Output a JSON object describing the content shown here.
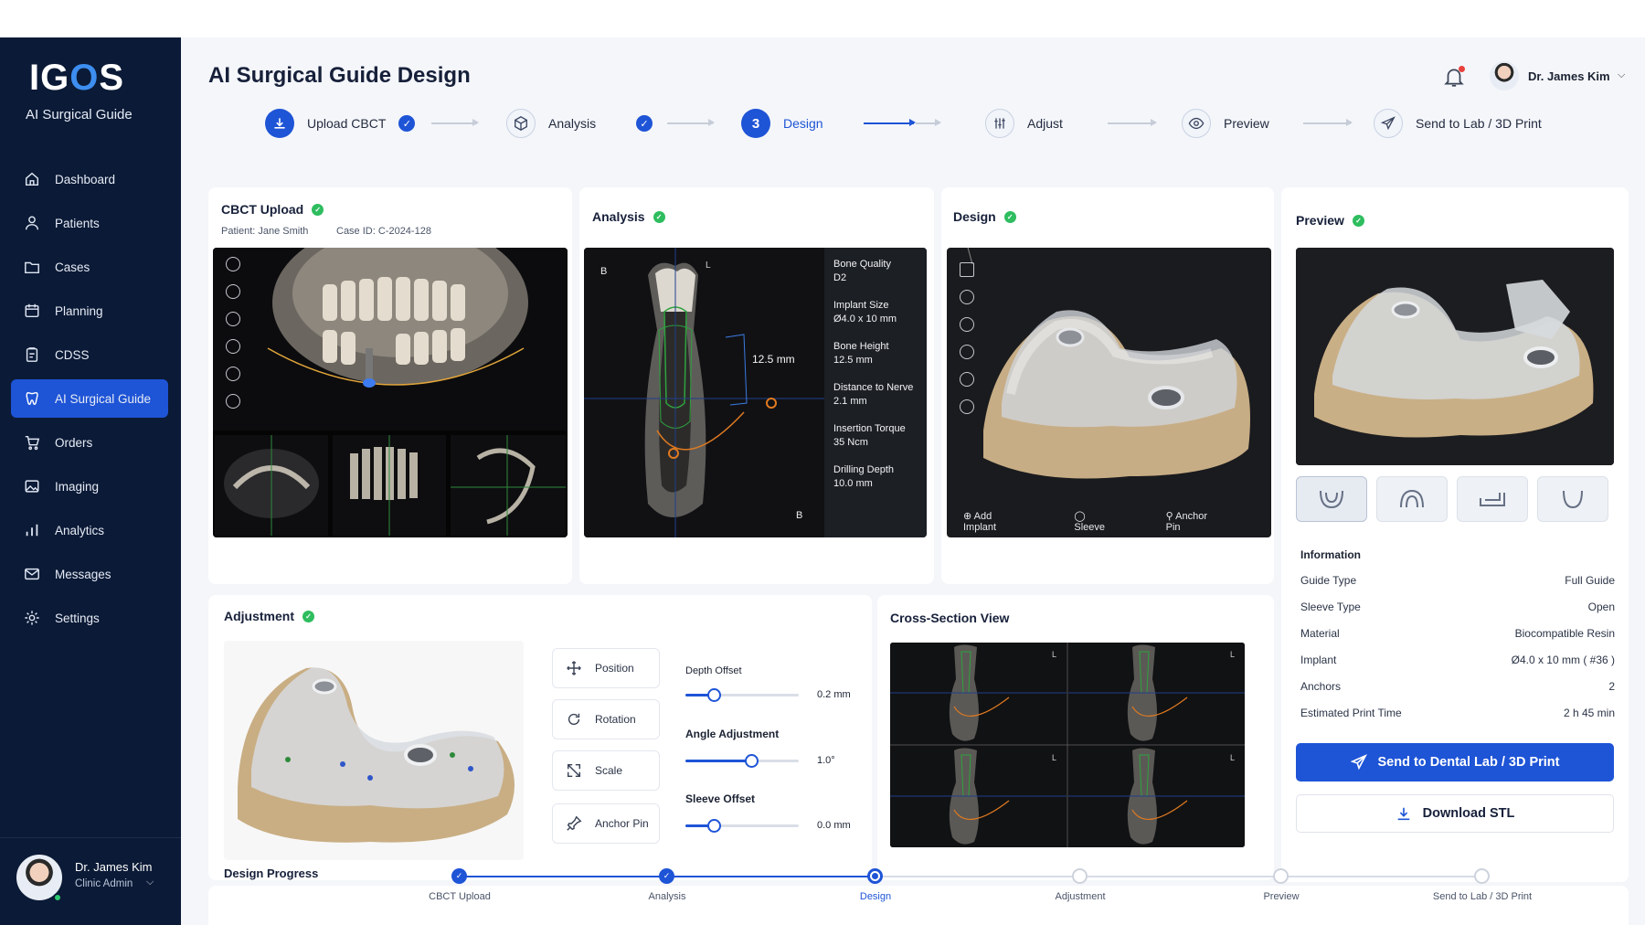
{
  "app": {
    "logo": "IGOS",
    "subtitle": "AI Surgical Guide"
  },
  "sidebar": {
    "items": [
      {
        "label": "Dashboard",
        "icon": "home-icon"
      },
      {
        "label": "Patients",
        "icon": "user-icon"
      },
      {
        "label": "Cases",
        "icon": "folder-icon"
      },
      {
        "label": "Planning",
        "icon": "calendar-icon"
      },
      {
        "label": "CDSS",
        "icon": "clipboard-icon"
      },
      {
        "label": "AI Surgical Guide",
        "icon": "tooth-icon",
        "active": true
      },
      {
        "label": "Orders",
        "icon": "cart-icon"
      },
      {
        "label": "Imaging",
        "icon": "image-icon"
      },
      {
        "label": "Analytics",
        "icon": "bar-chart-icon"
      },
      {
        "label": "Messages",
        "icon": "mail-icon"
      },
      {
        "label": "Settings",
        "icon": "gear-icon"
      }
    ],
    "user": {
      "name": "Dr. James Kim",
      "role": "Clinic Admin"
    }
  },
  "header": {
    "title": "AI Surgical Guide Design",
    "user_name": "Dr. James Kim"
  },
  "stepper": {
    "steps": [
      {
        "label": "Upload CBCT",
        "state": "done"
      },
      {
        "label": "Analysis",
        "state": "done"
      },
      {
        "label": "Design",
        "state": "active",
        "number": "3"
      },
      {
        "label": "Adjust",
        "state": "todo"
      },
      {
        "label": "Preview",
        "state": "todo"
      },
      {
        "label": "Send to Lab / 3D Print",
        "state": "todo"
      }
    ]
  },
  "cbct": {
    "title": "CBCT Upload",
    "patient": "Patient: Jane Smith",
    "case_id": "Case ID: C-2024-128"
  },
  "analysis": {
    "title": "Analysis",
    "labels": {
      "b_top": "B",
      "l_top": "L",
      "b_bottom": "B",
      "measure": "12.5 mm"
    },
    "info": [
      {
        "label": "Bone Quality",
        "value": "D2"
      },
      {
        "label": "Implant Size",
        "value": "Ø4.0 x 10 mm"
      },
      {
        "label": "Bone Height",
        "value": "12.5 mm"
      },
      {
        "label": "Distance to Nerve",
        "value": "2.1 mm"
      },
      {
        "label": "Insertion Torque",
        "value": "35 Ncm"
      },
      {
        "label": "Drilling Depth",
        "value": "10.0 mm"
      }
    ]
  },
  "design": {
    "title": "Design",
    "tools": [
      "Add Implant",
      "Sleeve",
      "Anchor Pin"
    ]
  },
  "preview": {
    "title": "Preview",
    "info_title": "Information",
    "info": [
      {
        "label": "Guide Type",
        "value": "Full Guide"
      },
      {
        "label": "Sleeve Type",
        "value": "Open"
      },
      {
        "label": "Material",
        "value": "Biocompatible Resin"
      },
      {
        "label": "Implant",
        "value": "Ø4.0 x 10 mm ( #36 )"
      },
      {
        "label": "Anchors",
        "value": "2"
      },
      {
        "label": "Estimated Print Time",
        "value": "2 h 45 min"
      }
    ],
    "send_button": "Send to Dental Lab / 3D Print",
    "download_button": "Download STL"
  },
  "adjustment": {
    "title": "Adjustment",
    "controls": [
      "Position",
      "Rotation",
      "Scale",
      "Anchor Pin"
    ],
    "sliders": [
      {
        "label": "Depth Offset",
        "value": "0.2 mm",
        "level": 0.25
      },
      {
        "label": "Angle Adjustment",
        "value": "1.0°",
        "level": 0.58
      },
      {
        "label": "Sleeve Offset",
        "value": "0.0 mm",
        "level": 0.25
      }
    ]
  },
  "cross_section": {
    "title": "Cross-Section View",
    "corner_label": "L"
  },
  "design_progress": {
    "title": "Design Progress",
    "steps": [
      {
        "label": "CBCT Upload",
        "state": "done"
      },
      {
        "label": "Analysis",
        "state": "done"
      },
      {
        "label": "Design",
        "state": "current"
      },
      {
        "label": "Adjustment",
        "state": "todo"
      },
      {
        "label": "Preview",
        "state": "todo"
      },
      {
        "label": "Send to Lab / 3D Print",
        "state": "todo"
      }
    ]
  },
  "colors": {
    "accent": "#1e54d6",
    "sidebar": "#0b1a36",
    "success": "#2ebd5f"
  }
}
